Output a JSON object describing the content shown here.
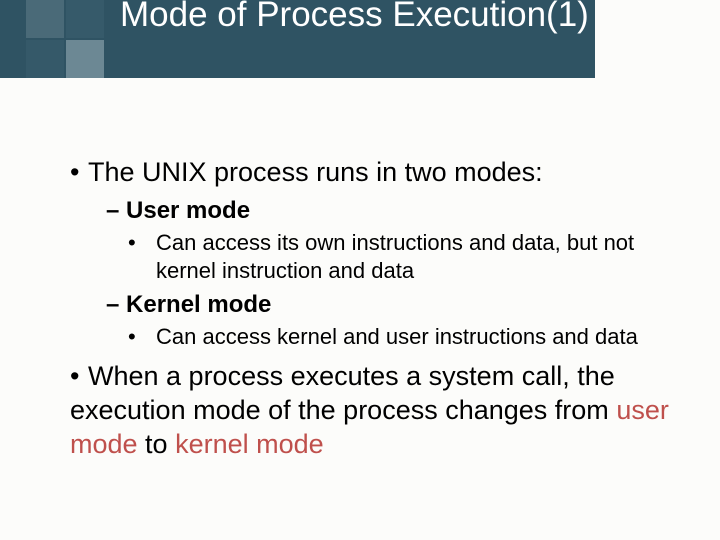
{
  "title": "Mode of Process Execution(1)",
  "b1": "The UNIX process runs in two modes:",
  "d1": "– User mode",
  "s1": "Can access its own instructions and data, but not kernel instruction and data",
  "d2": "– Kernel mode",
  "s2": "Can access kernel and user instructions and data",
  "b2_pre": "When a process executes a system call, the execution mode of the process changes from ",
  "b2_um": "user mode",
  "b2_mid": " to ",
  "b2_km": "kernel mode"
}
